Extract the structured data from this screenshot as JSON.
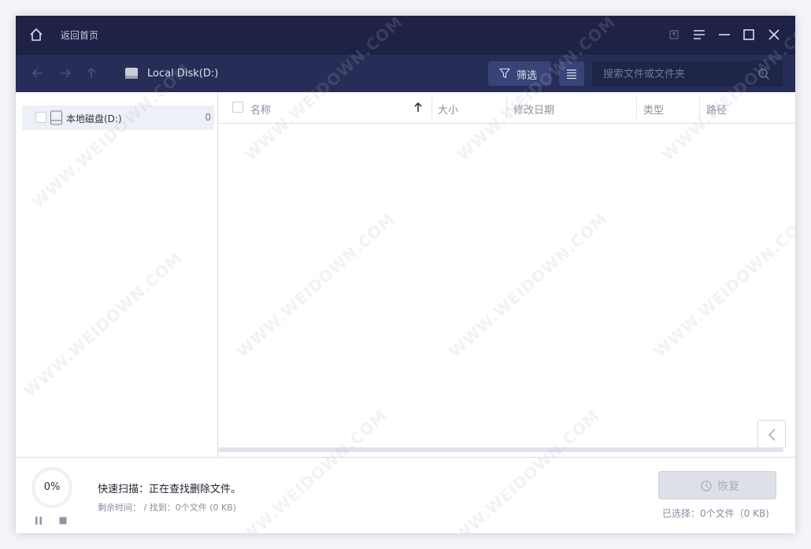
{
  "titlebar": {
    "back_home_label": "返回首页",
    "icons": [
      "home-icon",
      "upload-icon",
      "menu-icon",
      "minimize-icon",
      "maximize-icon",
      "close-icon"
    ]
  },
  "toolbar": {
    "location_label": "Local Disk(D:)",
    "filter_label": "筛选",
    "search_placeholder": "搜索文件或文件夹"
  },
  "tree": {
    "items": [
      {
        "label": "本地磁盘(D:)",
        "count": "0"
      }
    ]
  },
  "file_list": {
    "columns": [
      {
        "label": "名称"
      },
      {
        "label": "大小"
      },
      {
        "label": "修改日期"
      },
      {
        "label": "类型"
      },
      {
        "label": "路径"
      }
    ]
  },
  "status": {
    "progress_text": "0%",
    "progress_value": 0,
    "scan_title": "快速扫描：正在查找删除文件。",
    "scan_sub": "剩余时间：  / 找到：0个文件 (0 KB)",
    "recover_label": "恢复",
    "selected_info": "已选择：0个文件（0 KB)"
  },
  "watermark_text": "WWW.WEIDOWN.COM",
  "colors": {
    "titlebar_bg": "#1d2246",
    "toolbar_bg": "#262d56",
    "accent_button": "#3a4377",
    "progress_accent": "#3b6fd8"
  }
}
